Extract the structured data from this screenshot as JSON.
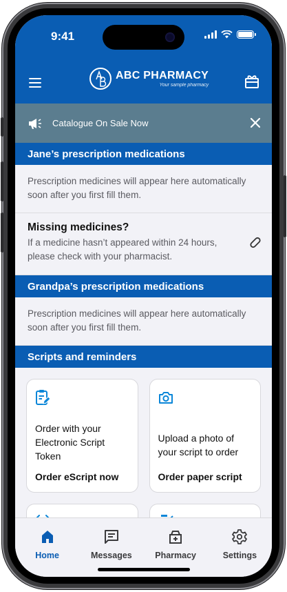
{
  "status_bar": {
    "time": "9:41"
  },
  "header": {
    "brand_name": "ABC PHARMACY",
    "brand_tagline": "Your sample pharmacy",
    "logo_letters": "AB"
  },
  "banner": {
    "text": "Catalogue On Sale Now"
  },
  "sections": {
    "jane": {
      "title": "Jane’s prescription medications",
      "empty_text": "Prescription medicines will appear here automatically soon after you first fill them."
    },
    "missing": {
      "title": "Missing medicines?",
      "body": "If a medicine hasn’t appeared within 24 hours, please check with your pharmacist."
    },
    "grandpa": {
      "title": "Grandpa’s prescription medications",
      "empty_text": "Prescription medicines will appear here automatically soon after you first fill them."
    },
    "scripts": {
      "title": "Scripts and reminders"
    }
  },
  "cards": [
    {
      "icon": "clipboard-edit-icon",
      "description": "Order with your Electronic Script Token",
      "action": "Order eScript now"
    },
    {
      "icon": "camera-icon",
      "description": "Upload a photo of your script to order",
      "action": "Order paper script"
    },
    {
      "icon": "alarm-clock-icon"
    },
    {
      "icon": "pill-bottle-icon"
    }
  ],
  "tabs": [
    {
      "icon": "home-icon",
      "label": "Home",
      "active": true
    },
    {
      "icon": "message-icon",
      "label": "Messages",
      "active": false
    },
    {
      "icon": "pharmacy-icon",
      "label": "Pharmacy",
      "active": false
    },
    {
      "icon": "gear-icon",
      "label": "Settings",
      "active": false
    }
  ],
  "colors": {
    "primary": "#0a5db3",
    "banner": "#5b7d8f",
    "card_icon": "#0a86d8",
    "background": "#f2f2f7"
  }
}
